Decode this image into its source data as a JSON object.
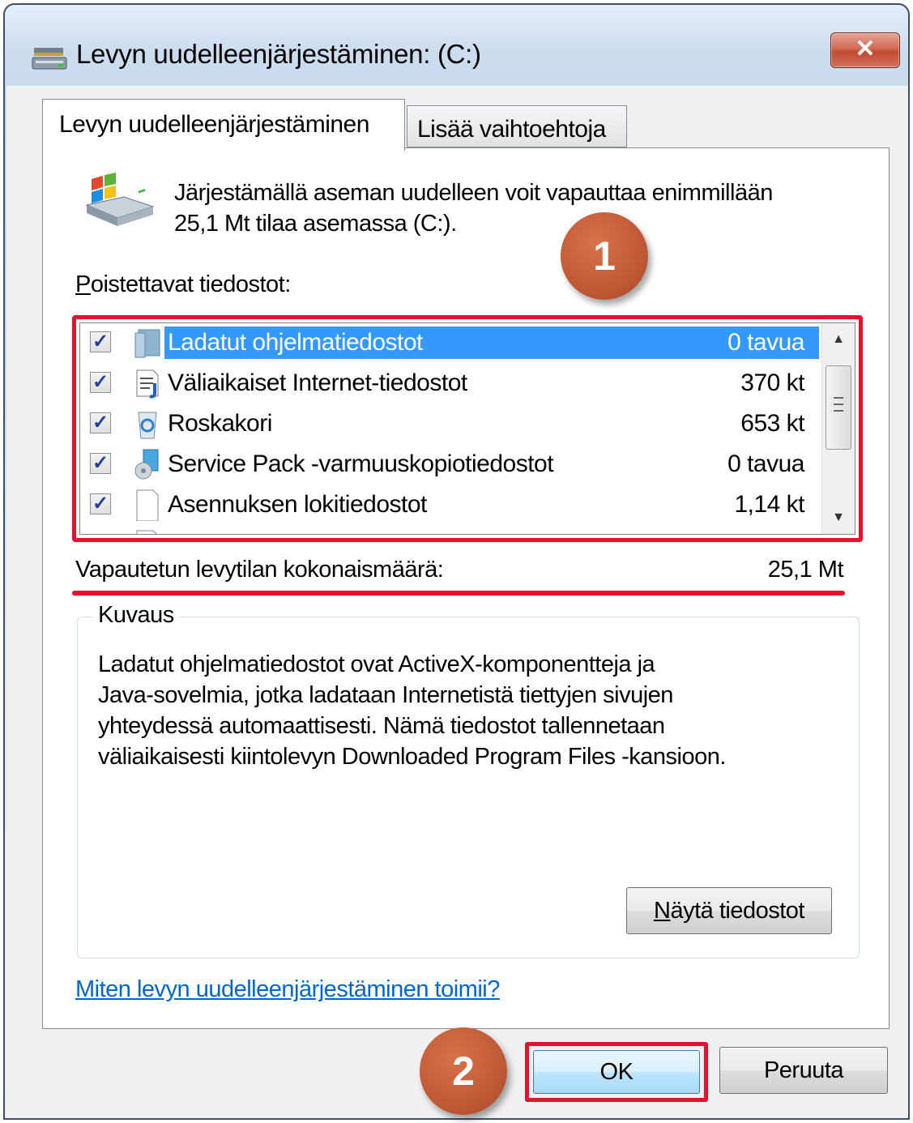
{
  "window": {
    "title": "Levyn uudelleenjärjestäminen:  (C:)",
    "close_label": "✕"
  },
  "tabs": [
    {
      "label": "Levyn uudelleenjärjestäminen",
      "active": true
    },
    {
      "label": "Lisää vaihtoehtoja",
      "active": false
    }
  ],
  "intro": {
    "line1": "Järjestämällä aseman uudelleen voit vapauttaa enimmillään",
    "line2": "25,1 Mt tilaa asemassa  (C:)."
  },
  "files_label_first": "P",
  "files_label_rest": "oistettavat tiedostot:",
  "file_list": [
    {
      "name": "Ladatut ohjelmatiedostot",
      "size": "0 tavua",
      "checked": true,
      "selected": true,
      "icon": "folder-icon"
    },
    {
      "name": "Väliaikaiset Internet-tiedostot",
      "size": "370 kt",
      "checked": true,
      "selected": false,
      "icon": "internet-file-icon"
    },
    {
      "name": "Roskakori",
      "size": "653 kt",
      "checked": true,
      "selected": false,
      "icon": "recycle-bin-icon"
    },
    {
      "name": "Service Pack -varmuuskopiotiedostot",
      "size": "0 tavua",
      "checked": true,
      "selected": false,
      "icon": "service-pack-icon"
    },
    {
      "name": "Asennuksen lokitiedostot",
      "size": "1,14 kt",
      "checked": true,
      "selected": false,
      "icon": "file-icon"
    }
  ],
  "total": {
    "label": "Vapautetun levytilan kokonaismäärä:",
    "value": "25,1 Mt"
  },
  "description": {
    "title": "Kuvaus",
    "lines": [
      "Ladatut ohjelmatiedostot ovat ActiveX-komponentteja ja",
      "Java-sovelmia, jotka ladataan Internetistä tiettyjen sivujen",
      "yhteydessä automaattisesti. Nämä tiedostot tallennetaan",
      "väliaikaisesti kiintolevyn Downloaded Program Files -kansioon."
    ],
    "view_files_first": "N",
    "view_files_rest": "äytä tiedostot"
  },
  "help_link": "Miten levyn uudelleenjärjestäminen toimii?",
  "buttons": {
    "ok": "OK",
    "cancel": "Peruuta"
  },
  "annotations": {
    "badge1": "1",
    "badge2": "2",
    "highlight_color": "#e8112d",
    "badge_color": "#c05a36"
  }
}
